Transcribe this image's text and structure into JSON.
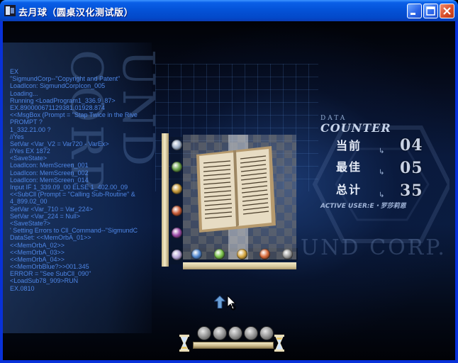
{
  "window": {
    "title": "去月球（圆桌汉化测试版）",
    "buttons": {
      "minimize": "minimize",
      "maximize": "maximize",
      "close": "close"
    }
  },
  "console_lines": [
    "EX",
    "\"SigmundCorp--\"Copyright and Patent\"",
    "LoadIcon: SigmundCorpIcon_005",
    "Loading...",
    "Running <LoadProgram1_336.9_87>",
    "EX.890000671129381.01928.874",
    "<<MsgBox (Prompt = \"Stap Twice in the Rive",
    "PROMPT ?",
    "  1_332.21.00 ?",
    " //Yes",
    "SetVar <Var_V2 = Var720 - VarEx>",
    " //Yes    EX 1872",
    "<SaveState>",
    "LoadIcon: MemScreen_001",
    "LoadIcon: MemScreen_002",
    "LoadIcon: MemScreen_014",
    "Input IF 1_339.09_00 ELSE 1_402.00_09",
    "<<SubCll (Prompt = \"Calling Sub-Routine\" &",
    "  4_899.02_00",
    "SetVar <Var_710 = Var_224>",
    "SetVar <Var_224 = Null>",
    "<SaveState?>",
    "' Setting Errors to Cll_Command--\"SigmundC",
    "DataSet: <<MemOrbA_01>>",
    "  <<MemOrbA_02>>",
    "  <<MemOrbA_03>>",
    "  <<MemOrbA_04>>",
    "  <<MemOrbBlue?>>001.345",
    "ERROR = \"See SubCll_090\"",
    "<LoadSub78_909>RUN",
    "EX.0810"
  ],
  "background_text": {
    "vertical": "UND CORP",
    "corp": "UND  CORP."
  },
  "counter": {
    "heading_small": "DATA",
    "heading_large": "COUNTER",
    "rows": [
      {
        "label": "当前",
        "value": "04"
      },
      {
        "label": "最佳",
        "value": "05"
      },
      {
        "label": "总计",
        "value": "35"
      }
    ],
    "active_user_label": "ACTIVE USER",
    "active_user_value": ":E・罗莎莉恩"
  },
  "puzzle": {
    "left_orbs": [
      "#9fb0c8",
      "#6aa24a",
      "#c79a3a",
      "#c85a36",
      "#9a4aa8",
      "#b7a6d8"
    ],
    "bottom_orbs": [
      "#4f86d0",
      "#7ac24a",
      "#d6a640",
      "#d86a3a",
      "#9c9c9c"
    ]
  },
  "timer": {
    "tokens": 5
  },
  "colors": {
    "console_text": "#4e86e6",
    "title_bar": "#0453d8",
    "counter_text": "#c9d2e4"
  }
}
